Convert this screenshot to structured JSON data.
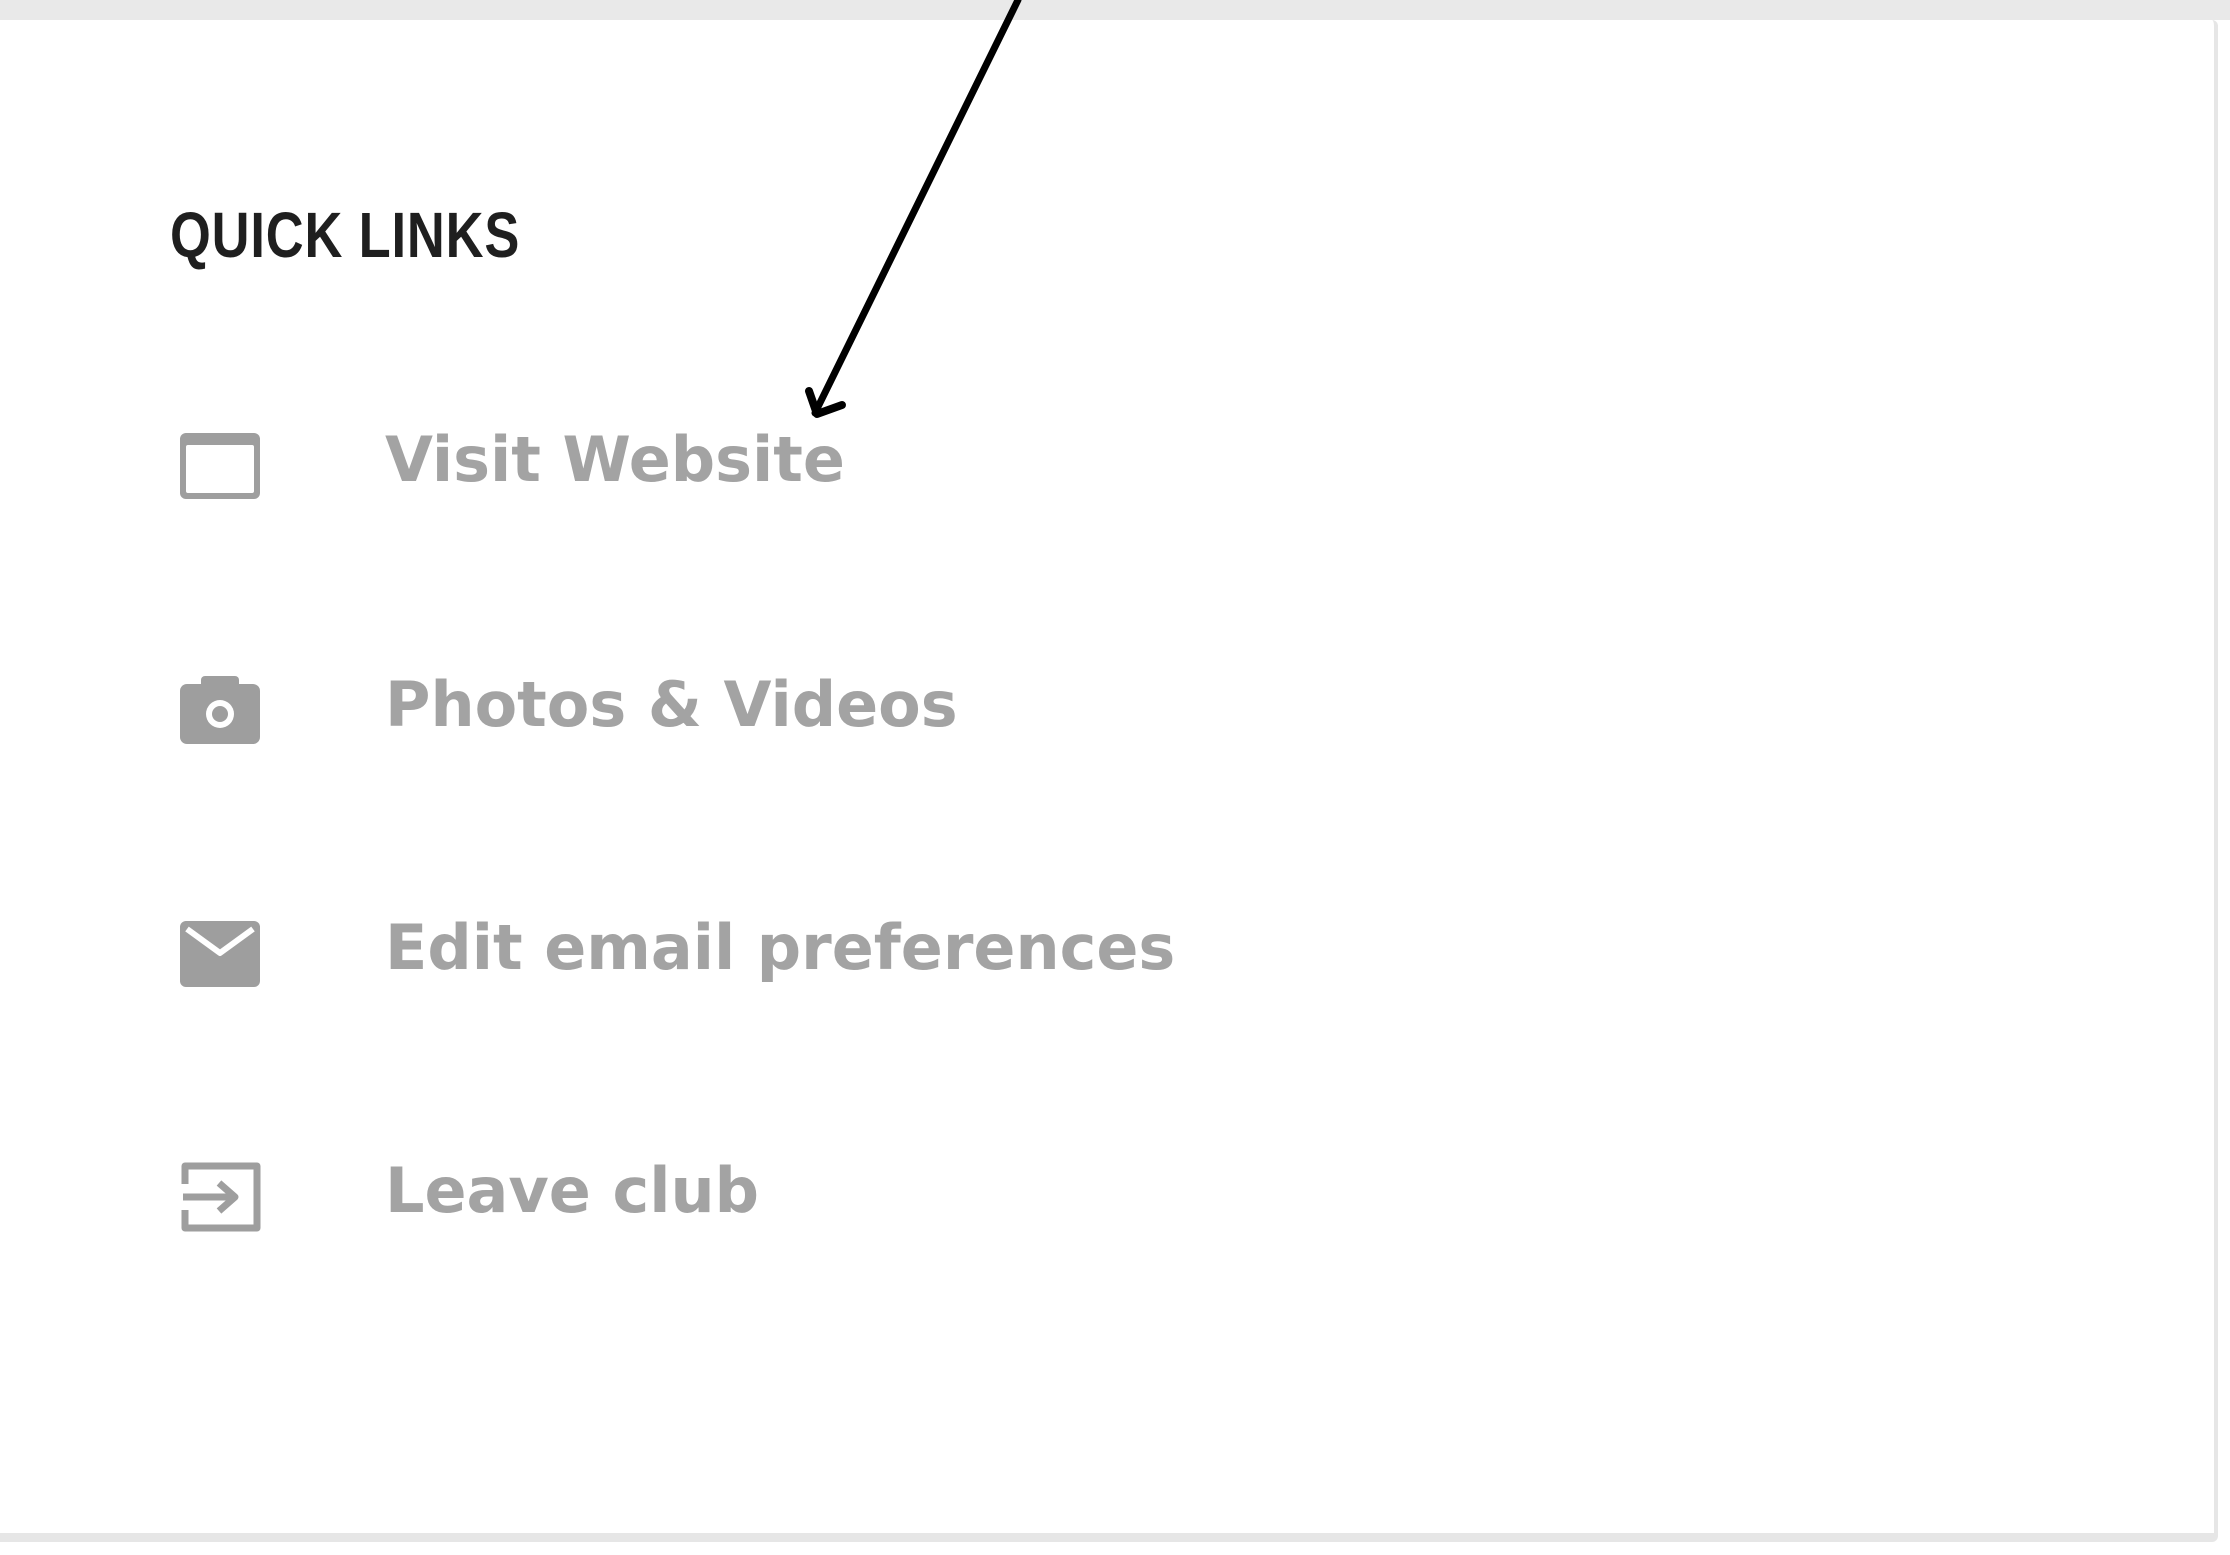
{
  "quick_links": {
    "title": "QUICK LINKS",
    "items": [
      {
        "label": "Visit Website",
        "icon": "browser-window-icon"
      },
      {
        "label": "Photos & Videos",
        "icon": "camera-icon"
      },
      {
        "label": "Edit email preferences",
        "icon": "envelope-icon"
      },
      {
        "label": "Leave club",
        "icon": "exit-door-icon"
      }
    ]
  },
  "colors": {
    "title": "#1f1f1f",
    "link_text": "#a3a3a3",
    "icon": "#9e9e9e",
    "card_border": "#e6e6e6",
    "annotation_arrow": "#000000"
  }
}
